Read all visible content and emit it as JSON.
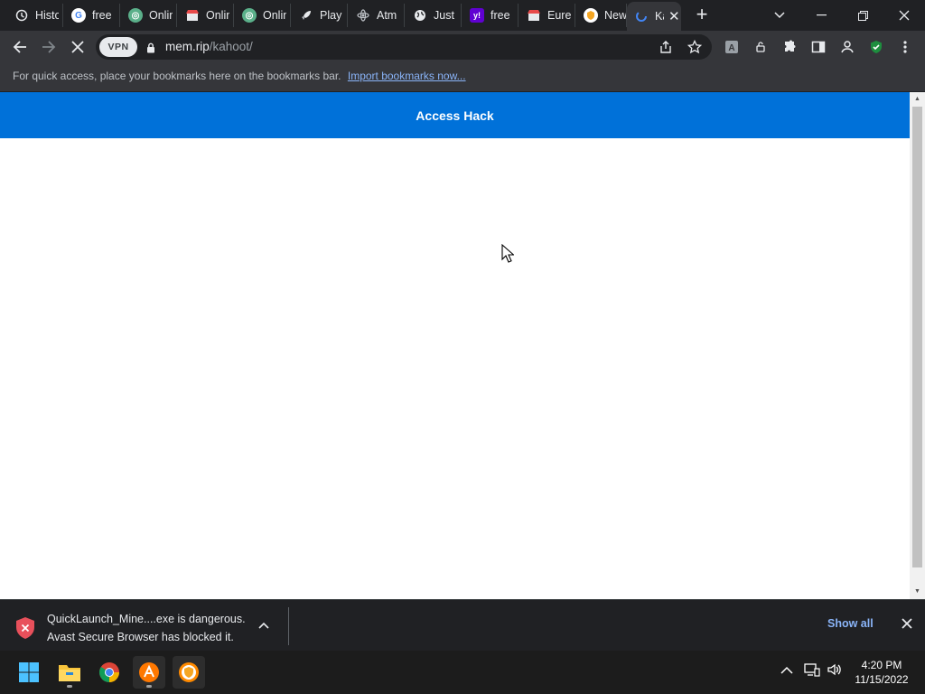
{
  "tabs": [
    {
      "title": "History",
      "icon": "history-icon",
      "color": "#e8eaed"
    },
    {
      "title": "free",
      "icon": "google-icon",
      "color": "#4285f4"
    },
    {
      "title": "Online",
      "icon": "circle-logo-icon",
      "color": "#5bb08a"
    },
    {
      "title": "Online",
      "icon": "shop-icon",
      "color": "#e8eaed"
    },
    {
      "title": "Online",
      "icon": "circle-logo-icon",
      "color": "#5bb08a"
    },
    {
      "title": "Play",
      "icon": "rocket-icon",
      "color": "#e8eaed"
    },
    {
      "title": "Atm",
      "icon": "atom-icon",
      "color": "#bdc1c6"
    },
    {
      "title": "Just",
      "icon": "globe-icon",
      "color": "#e8eaed"
    },
    {
      "title": "free",
      "icon": "yahoo-icon",
      "color": "#6001d2"
    },
    {
      "title": "Eure",
      "icon": "shop-icon",
      "color": "#e8eaed"
    },
    {
      "title": "New",
      "icon": "avast-icon",
      "color": "#f5a623"
    },
    {
      "title": "Kahoot",
      "icon": "loading-icon",
      "color": "#4285f4"
    }
  ],
  "toolbar": {
    "vpn_label": "VPN",
    "url_domain": "mem.rip",
    "url_path": "/kahoot/"
  },
  "bookmarks": {
    "hint": "For quick access, place your bookmarks here on the bookmarks bar.",
    "import_link": "Import bookmarks now..."
  },
  "page": {
    "banner_text": "Access Hack",
    "banner_color": "#0071d9"
  },
  "download": {
    "line1": "QuickLaunch_Mine....exe is dangerous.",
    "line2": "Avast Secure Browser has blocked it.",
    "show_all": "Show all"
  },
  "taskbar": {
    "apps": [
      "start-icon",
      "file-explorer-icon",
      "chrome-icon",
      "avast-app-icon",
      "avast-browser-icon"
    ],
    "time": "4:20 PM",
    "date": "11/15/2022"
  }
}
